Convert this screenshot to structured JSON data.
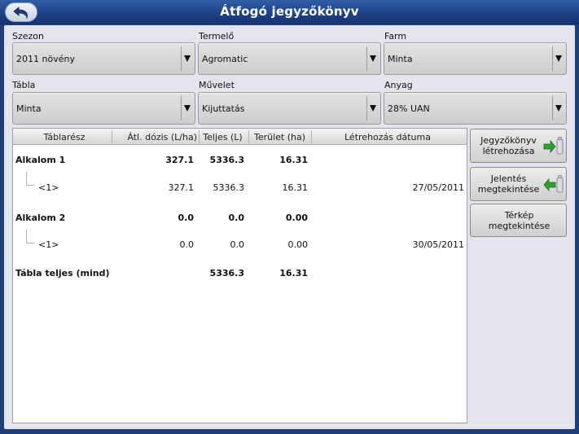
{
  "window": {
    "title": "Átfogó jegyzőkönyv"
  },
  "filters": [
    {
      "label": "Szezon",
      "value": "2011 növény"
    },
    {
      "label": "Termelő",
      "value": "Agromatic"
    },
    {
      "label": "Farm",
      "value": "Minta"
    },
    {
      "label": "Tábla",
      "value": "Minta"
    },
    {
      "label": "Művelet",
      "value": "Kijuttatás"
    },
    {
      "label": "Anyag",
      "value": "28% UAN"
    }
  ],
  "table": {
    "columns": [
      "Táblarész",
      "Átl. dózis (L/ha)",
      "Teljes (L)",
      "Terület (ha)",
      "Létrehozás dátuma"
    ],
    "rows": [
      {
        "name": "Alkalom 1",
        "rate": "327.1",
        "total": "5336.3",
        "area": "16.31",
        "date": "",
        "bold": true
      },
      {
        "name": "<1>",
        "rate": "327.1",
        "total": "5336.3",
        "area": "16.31",
        "date": "27/05/2011",
        "bold": false
      },
      {
        "name": "Alkalom 2",
        "rate": "0.0",
        "total": "0.0",
        "area": "0.00",
        "date": "",
        "bold": true
      },
      {
        "name": "<1>",
        "rate": "0.0",
        "total": "0.0",
        "area": "0.00",
        "date": "30/05/2011",
        "bold": false
      },
      {
        "name": "Tábla teljes (mind)",
        "rate": "",
        "total": "5336.3",
        "area": "16.31",
        "date": "",
        "bold": true
      }
    ]
  },
  "buttons": {
    "create_report": "Jegyzőkönyv létrehozása",
    "view_report": "Jelentés megtekintése",
    "view_map": "Térkép megtekintése"
  },
  "colors": {
    "titlebar": "#1d4286",
    "panel": "#e4e5ec",
    "arrow_green": "#2fa12f"
  },
  "icons": {
    "back": "back-arrow-icon",
    "export": "export-to-usb-icon",
    "import": "import-from-usb-icon"
  }
}
